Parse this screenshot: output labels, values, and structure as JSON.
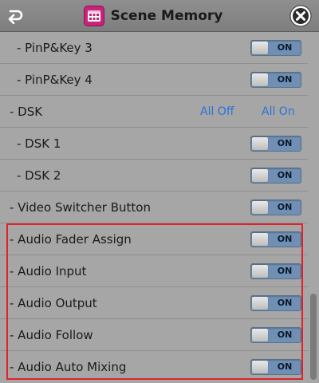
{
  "header": {
    "title": "Scene Memory",
    "icons": {
      "back": "back-arrow-icon",
      "title": "film-grid-icon",
      "close": "close-circle-icon"
    },
    "colors": {
      "title_icon_bg": "#c8227a"
    }
  },
  "rows": [
    {
      "label": "- PinP&Key 3",
      "toggle": "ON",
      "level": "sub"
    },
    {
      "label": "- PinP&Key 4",
      "toggle": "ON",
      "level": "sub"
    },
    {
      "label": "- DSK",
      "level": "top",
      "all_off": "All Off",
      "all_on": "All On"
    },
    {
      "label": "- DSK 1",
      "toggle": "ON",
      "level": "sub"
    },
    {
      "label": "- DSK 2",
      "toggle": "ON",
      "level": "sub"
    },
    {
      "label": "- Video Switcher Button",
      "toggle": "ON",
      "level": "top"
    },
    {
      "label": "- Audio Fader Assign",
      "toggle": "ON",
      "level": "top"
    },
    {
      "label": "- Audio Input",
      "toggle": "ON",
      "level": "top"
    },
    {
      "label": "- Audio Output",
      "toggle": "ON",
      "level": "top"
    },
    {
      "label": "- Audio Follow",
      "toggle": "ON",
      "level": "top"
    },
    {
      "label": "- Audio Auto Mixing",
      "toggle": "ON",
      "level": "top"
    }
  ],
  "colors": {
    "toggle_on": "#6f8fb4",
    "link": "#2a72d8",
    "highlight": "#e0202a"
  }
}
